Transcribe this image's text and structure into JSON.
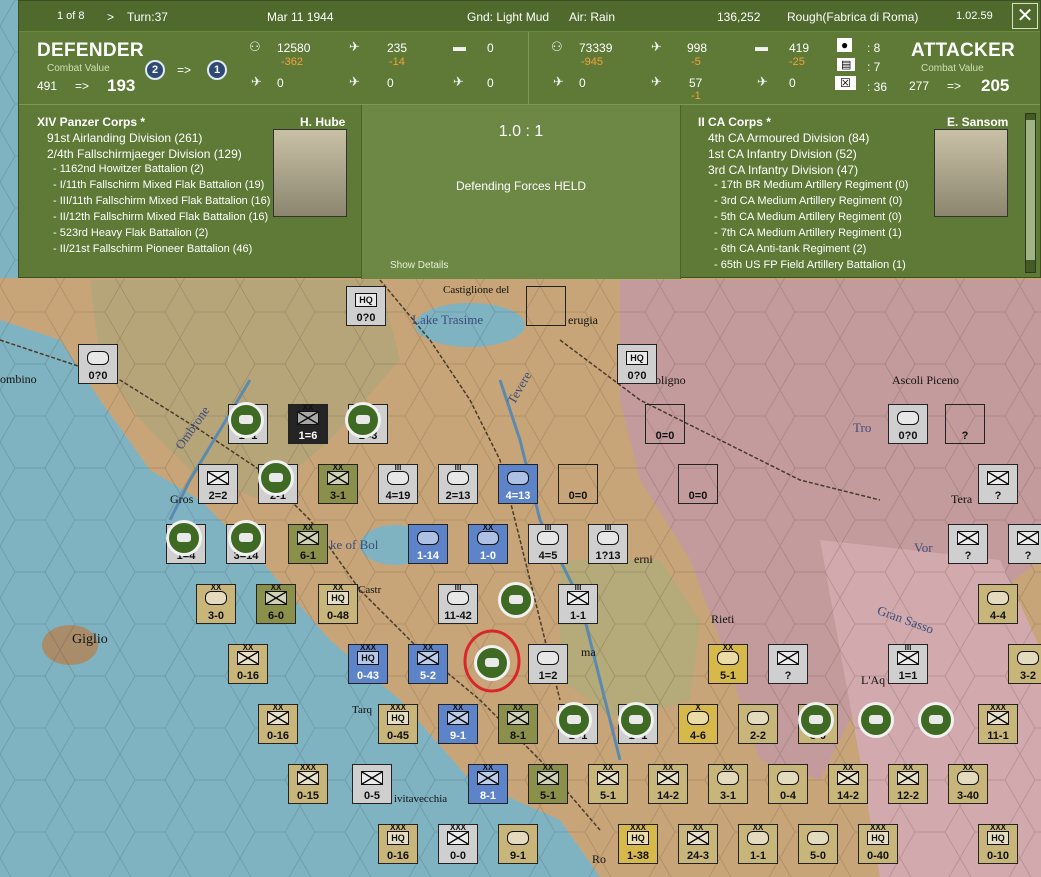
{
  "topbar": {
    "page": "1 of 8",
    "arrow": ">",
    "turn": "Turn:37",
    "date": "Mar 11 1944",
    "ground": "Gnd: Light Mud",
    "air": "Air: Rain",
    "score": "136,252",
    "terrain": "Rough(Fabrica di Roma)",
    "version": "1.02.59",
    "close": "✕"
  },
  "defender": {
    "title": "DEFENDER",
    "cv_label": "Combat Value",
    "cv_before": "491",
    "arrow": "=>",
    "cv_after": "193",
    "badge_from": "2",
    "badge_arrow": "=>",
    "badge_to": "1",
    "men": "12580",
    "men_loss": "-362",
    "air": "235",
    "air_loss": "-14",
    "tanks": "0",
    "fighters": "0",
    "bombers": "0",
    "other_air": "0"
  },
  "attacker": {
    "title": "ATTACKER",
    "cv_label": "Combat Value",
    "cv_before": "277",
    "arrow": "=>",
    "cv_after": "205",
    "men": "73339",
    "men_loss": "-945",
    "air": "998",
    "air_loss": "-5",
    "tanks": "419",
    "tanks_loss": "-25",
    "fighters": "0",
    "bombers": "57",
    "bombers_loss": "-1",
    "other_air": "0",
    "units_a": ": 8",
    "units_b": ": 7",
    "units_c": ": 36"
  },
  "result": {
    "ratio": "1.0 : 1",
    "outcome": "Defending Forces HELD",
    "details_link": "Show Details"
  },
  "defender_oob": {
    "corps": "XIV Panzer Corps *",
    "commander": "H. Hube",
    "lines": [
      {
        "text": "91st Airlanding Division (261)",
        "lvl": 1
      },
      {
        "text": "2/4th Fallschirmjaeger Division (129)",
        "lvl": 1
      },
      {
        "text": "- 1162nd Howitzer Battalion (2)",
        "lvl": 2
      },
      {
        "text": "- I/11th Fallschirm Mixed Flak Battalion (19)",
        "lvl": 2
      },
      {
        "text": "- III/11th Fallschirm Mixed Flak Battalion (16)",
        "lvl": 2
      },
      {
        "text": "- II/12th Fallschirm Mixed Flak Battalion (16)",
        "lvl": 2
      },
      {
        "text": "- 523rd Heavy Flak Battalion (2)",
        "lvl": 2
      },
      {
        "text": "- II/21st Fallschirm Pioneer Battalion (46)",
        "lvl": 2
      }
    ]
  },
  "attacker_oob": {
    "corps": "II CA Corps *",
    "commander": "E. Sansom",
    "lines": [
      {
        "text": "4th CA Armoured Division (84)",
        "lvl": 1
      },
      {
        "text": "1st CA Infantry Division (52)",
        "lvl": 1
      },
      {
        "text": "3rd CA Infantry Division (47)",
        "lvl": 1
      },
      {
        "text": "- 17th BR Medium Artillery Regiment (0)",
        "lvl": 2
      },
      {
        "text": "- 3rd CA Medium Artillery Regiment (0)",
        "lvl": 2
      },
      {
        "text": "- 5th CA Medium Artillery Regiment (0)",
        "lvl": 2
      },
      {
        "text": "- 7th CA Medium Artillery Regiment (1)",
        "lvl": 2
      },
      {
        "text": "- 6th CA Anti-tank Regiment (2)",
        "lvl": 2
      },
      {
        "text": "- 65th US FP Field Artillery Battalion (1)",
        "lvl": 2
      }
    ]
  },
  "map_labels": {
    "castiglione": "Castiglione del",
    "lake_trasimeno": "Lake Trasime",
    "perugia": "erugia",
    "piombino": "ombino",
    "foligno": "oligno",
    "ascoli": "Ascoli Piceno",
    "tevere": "Tevere",
    "ombrone": "Ombrone",
    "grosseto": "Gros",
    "lake_bolsena": "ke of Bol",
    "orbetello": "rlena di Castr",
    "terni": "erni",
    "rieti": "Rieti",
    "gran_sasso": "Gran Sasso",
    "giglio": "Giglio",
    "aquila": "L'Aq",
    "tarquinia": "Tarq",
    "civitavecchia": "ivitavecchia",
    "roma": "ma",
    "teramo": "Tera",
    "tro": "Tro",
    "vor": "Vor",
    "ro": "Ro"
  },
  "counters": [
    {
      "id": "hq-castiglione",
      "val": "0?0",
      "style": "gray",
      "kind": "hq",
      "hq": "HQ",
      "size": ""
    },
    {
      "id": "div-piombino",
      "val": "0?0",
      "style": "gray",
      "kind": "box",
      "size": ""
    },
    {
      "id": "hq-foligno",
      "val": "0?0",
      "style": "gray",
      "kind": "hq",
      "hq": "HQ",
      "size": ""
    },
    {
      "id": "r-perugia",
      "val": "",
      "style": "stripe",
      "kind": "r",
      "size": ""
    },
    {
      "id": "r-foligno",
      "val": "0=0",
      "style": "stripe",
      "kind": "r",
      "size": ""
    },
    {
      "id": "r-east",
      "val": "?",
      "style": "stripe",
      "kind": "r",
      "size": ""
    },
    {
      "id": "box-tro",
      "val": "0?0",
      "style": "gray",
      "kind": "box",
      "size": ""
    },
    {
      "id": "u1",
      "val": "1=1",
      "style": "gray",
      "kind": "inf",
      "size": "III"
    },
    {
      "id": "u2",
      "val": "1=6",
      "style": "black",
      "kind": "inf",
      "size": "XX"
    },
    {
      "id": "u3",
      "val": "1=3",
      "style": "gray",
      "kind": "inf",
      "size": "III"
    },
    {
      "id": "u4",
      "val": "2=2",
      "style": "gray",
      "kind": "inf",
      "size": ""
    },
    {
      "id": "u5",
      "val": "2-1",
      "style": "gray",
      "kind": "tank",
      "size": ""
    },
    {
      "id": "u6",
      "val": "3-1",
      "style": "green",
      "kind": "inf",
      "size": "XX"
    },
    {
      "id": "u7",
      "val": "4=19",
      "style": "gray",
      "kind": "tank",
      "size": "III"
    },
    {
      "id": "u8",
      "val": "2=13",
      "style": "gray",
      "kind": "tank",
      "size": "III"
    },
    {
      "id": "u9",
      "val": "4=13",
      "style": "blue",
      "kind": "tank",
      "size": ""
    },
    {
      "id": "u10",
      "val": "0=0",
      "style": "stripe",
      "kind": "r",
      "size": ""
    },
    {
      "id": "u11",
      "val": "0=0",
      "style": "stripe",
      "kind": "r",
      "size": ""
    },
    {
      "id": "u12",
      "val": "?",
      "style": "gray",
      "kind": "inf",
      "size": ""
    },
    {
      "id": "u13",
      "val": "1=4",
      "style": "gray",
      "kind": "tank",
      "size": ""
    },
    {
      "id": "u14",
      "val": "3=14",
      "style": "gray",
      "kind": "tank",
      "size": ""
    },
    {
      "id": "u15",
      "val": "6-1",
      "style": "green",
      "kind": "inf",
      "size": "XX"
    },
    {
      "id": "u16",
      "val": "1-14",
      "style": "blue",
      "kind": "tank",
      "size": ""
    },
    {
      "id": "u17",
      "val": "1-0",
      "style": "blue",
      "kind": "tank",
      "size": "XX"
    },
    {
      "id": "u18",
      "val": "4=5",
      "style": "gray",
      "kind": "tank",
      "size": "III"
    },
    {
      "id": "u19",
      "val": "1?13",
      "style": "gray",
      "kind": "tank",
      "size": "III"
    },
    {
      "id": "u20",
      "val": "?",
      "style": "gray",
      "kind": "inf",
      "size": ""
    },
    {
      "id": "u21",
      "val": "?",
      "style": "gray",
      "kind": "inf",
      "size": ""
    },
    {
      "id": "u22",
      "val": "3-0",
      "style": "khaki",
      "kind": "tank",
      "size": "XX"
    },
    {
      "id": "u23",
      "val": "6-0",
      "style": "green",
      "kind": "inf",
      "size": "XX"
    },
    {
      "id": "u24",
      "val": "0-48",
      "style": "khaki",
      "kind": "hq",
      "hq": "HQ",
      "size": "XX"
    },
    {
      "id": "u25",
      "val": "11-42",
      "style": "gray",
      "kind": "tank",
      "size": "III"
    },
    {
      "id": "u26",
      "val": "1-1",
      "style": "gray",
      "kind": "inf",
      "size": "III"
    },
    {
      "id": "u27",
      "val": "4-4",
      "style": "khaki",
      "kind": "tank",
      "size": ""
    },
    {
      "id": "u28",
      "val": "0-16",
      "style": "khaki",
      "kind": "inf",
      "size": "XX"
    },
    {
      "id": "u29",
      "val": "0-43",
      "style": "blue",
      "kind": "hq",
      "hq": "HQ",
      "size": "XXX"
    },
    {
      "id": "u30",
      "val": "5-2",
      "style": "blue",
      "kind": "inf",
      "size": "XX"
    },
    {
      "id": "u31",
      "val": "1=2",
      "style": "gray",
      "kind": "tank",
      "size": ""
    },
    {
      "id": "u32",
      "val": "5-1",
      "style": "gold",
      "kind": "tank",
      "size": "XX"
    },
    {
      "id": "u33",
      "val": "?",
      "style": "gray",
      "kind": "inf",
      "size": ""
    },
    {
      "id": "u34",
      "val": "1=1",
      "style": "gray",
      "kind": "inf",
      "size": "III"
    },
    {
      "id": "u35",
      "val": "3-2",
      "style": "khaki",
      "kind": "tank",
      "size": ""
    },
    {
      "id": "u36",
      "val": "0-16",
      "style": "khaki",
      "kind": "inf",
      "size": "XX"
    },
    {
      "id": "u37",
      "val": "0-45",
      "style": "khaki",
      "kind": "hq",
      "hq": "HQ",
      "size": "XXX"
    },
    {
      "id": "u38",
      "val": "9-1",
      "style": "blue",
      "kind": "inf",
      "size": "XX"
    },
    {
      "id": "u39",
      "val": "8-1",
      "style": "green",
      "kind": "inf",
      "size": "XX"
    },
    {
      "id": "u40",
      "val": "1=1",
      "style": "gray",
      "kind": "tank",
      "size": ""
    },
    {
      "id": "u41",
      "val": "1=1",
      "style": "gray",
      "kind": "tank",
      "size": ""
    },
    {
      "id": "u42",
      "val": "4-6",
      "style": "gold",
      "kind": "tank",
      "size": "X"
    },
    {
      "id": "u43",
      "val": "2-2",
      "style": "khaki",
      "kind": "tank",
      "size": ""
    },
    {
      "id": "u44",
      "val": "3-0",
      "style": "khaki",
      "kind": "tank",
      "size": ""
    },
    {
      "id": "u45",
      "val": "11-1",
      "style": "khaki",
      "kind": "inf",
      "size": "XXX"
    },
    {
      "id": "u46",
      "val": "0-15",
      "style": "khaki",
      "kind": "inf",
      "size": "XXX"
    },
    {
      "id": "u47",
      "val": "0-5",
      "style": "gray",
      "kind": "inf",
      "size": ""
    },
    {
      "id": "u48",
      "val": "8-1",
      "style": "blue",
      "kind": "inf",
      "size": "XX"
    },
    {
      "id": "u49",
      "val": "5-1",
      "style": "green",
      "kind": "inf",
      "size": "XX"
    },
    {
      "id": "u50",
      "val": "5-1",
      "style": "khaki",
      "kind": "inf",
      "size": "XX"
    },
    {
      "id": "u51",
      "val": "14-2",
      "style": "khaki",
      "kind": "inf",
      "size": "XX"
    },
    {
      "id": "u52",
      "val": "3-1",
      "style": "khaki",
      "kind": "tank",
      "size": "XX"
    },
    {
      "id": "u53",
      "val": "0-4",
      "style": "khaki",
      "kind": "tank",
      "size": ""
    },
    {
      "id": "u54",
      "val": "14-2",
      "style": "khaki",
      "kind": "inf",
      "size": "XX"
    },
    {
      "id": "u55",
      "val": "12-2",
      "style": "khaki",
      "kind": "inf",
      "size": "XX"
    },
    {
      "id": "u56",
      "val": "3-40",
      "style": "khaki",
      "kind": "tank",
      "size": "XX"
    },
    {
      "id": "u57",
      "val": "0-16",
      "style": "khaki",
      "kind": "hq",
      "hq": "HQ",
      "size": "XXX"
    },
    {
      "id": "u58",
      "val": "0-0",
      "style": "gray",
      "kind": "inf",
      "size": "XXX"
    },
    {
      "id": "u59",
      "val": "9-1",
      "style": "khaki",
      "kind": "tank",
      "size": ""
    },
    {
      "id": "u60",
      "val": "1-38",
      "style": "gold",
      "kind": "hq",
      "hq": "HQ",
      "size": "XXX"
    },
    {
      "id": "u61",
      "val": "24-3",
      "style": "khaki",
      "kind": "inf",
      "size": "XX"
    },
    {
      "id": "u62",
      "val": "1-1",
      "style": "khaki",
      "kind": "tank",
      "size": "XX"
    },
    {
      "id": "u63",
      "val": "5-0",
      "style": "khaki",
      "kind": "tank",
      "size": ""
    },
    {
      "id": "u64",
      "val": "0-40",
      "style": "khaki",
      "kind": "hq",
      "hq": "HQ",
      "size": "XXX"
    },
    {
      "id": "u65",
      "val": "0-10",
      "style": "khaki",
      "kind": "hq",
      "hq": "HQ",
      "size": "XXX"
    },
    {
      "id": "u66",
      "val": "?",
      "style": "gray",
      "kind": "inf",
      "size": ""
    },
    {
      "id": "u67",
      "val": "?",
      "style": "gray",
      "kind": "inf",
      "size": ""
    }
  ],
  "colors": {
    "panel": "#5f7a37",
    "sea": "#7fb3c2",
    "land_tan": "#c49b6e",
    "mountain": "#c79da0",
    "selection_ring": "#d9262b"
  }
}
